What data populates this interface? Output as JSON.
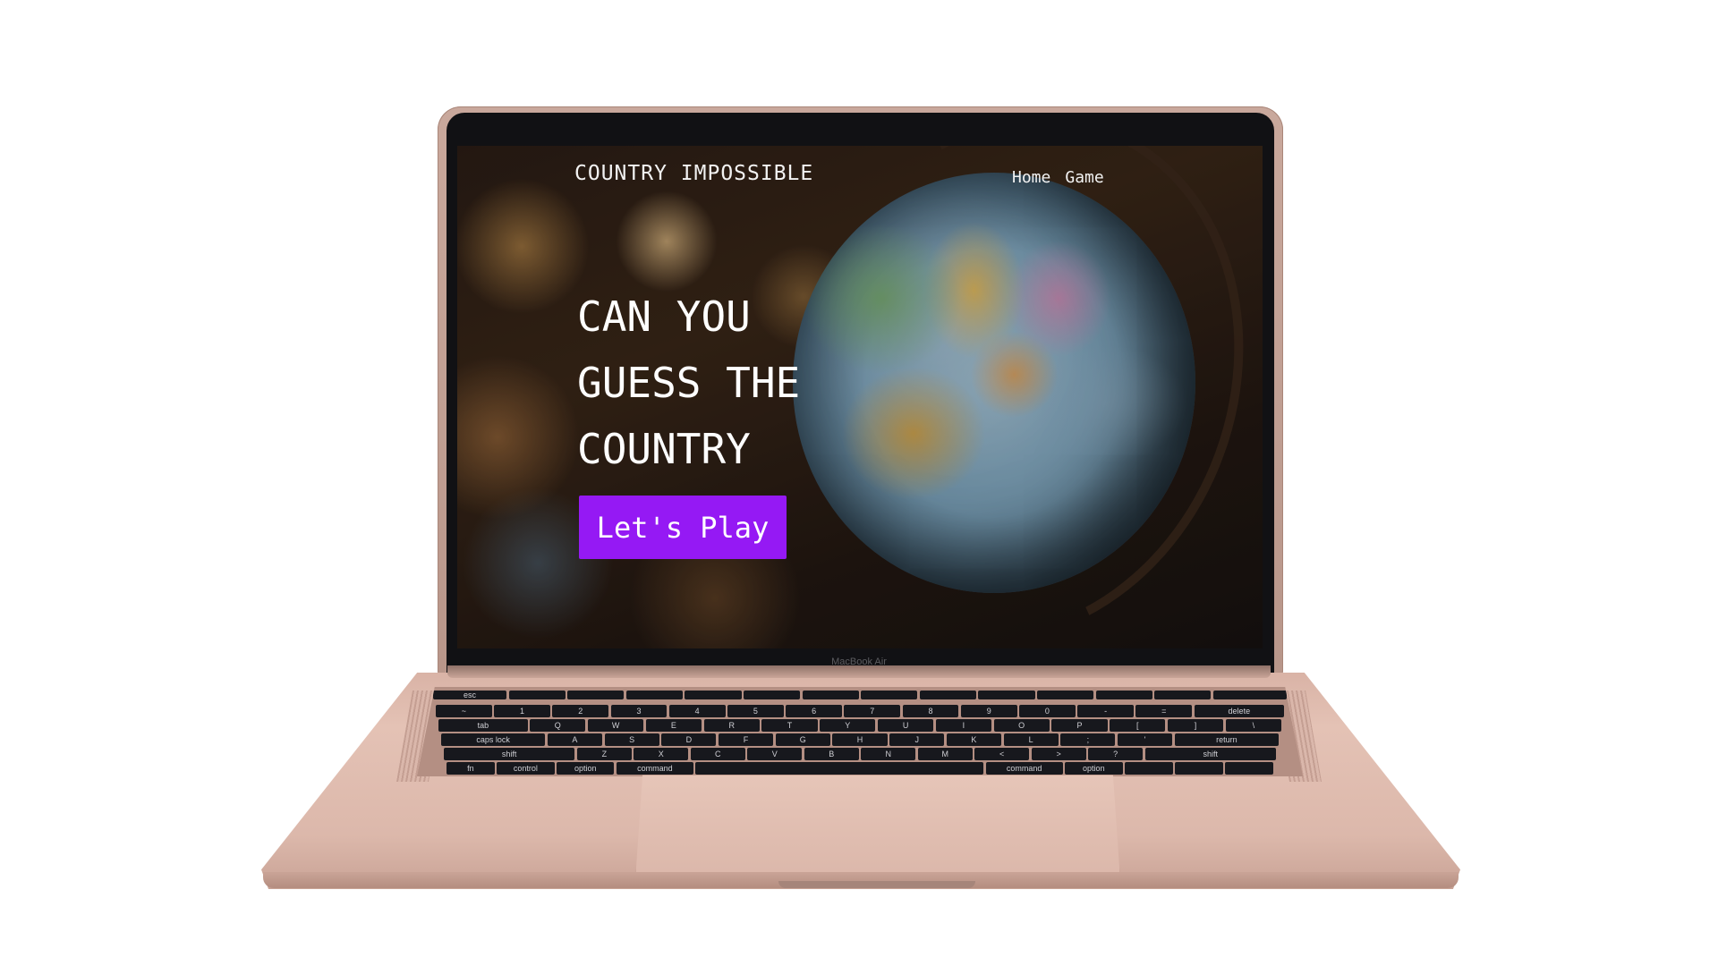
{
  "device": {
    "brand_label": "MacBook Air"
  },
  "site": {
    "logo": "COUNTRY IMPOSSIBLE",
    "nav": [
      {
        "label": "Home"
      },
      {
        "label": "Game"
      }
    ],
    "hero": {
      "lines": [
        "CAN YOU",
        "GUESS THE",
        "COUNTRY"
      ]
    },
    "cta": {
      "label": "Let's Play",
      "color": "#9519f4"
    }
  },
  "keyboard": {
    "rows": [
      [
        "esc",
        "",
        "",
        "",
        "",
        "",
        "",
        "",
        "",
        "",
        "",
        "",
        "",
        ""
      ],
      [
        "~",
        "1",
        "2",
        "3",
        "4",
        "5",
        "6",
        "7",
        "8",
        "9",
        "0",
        "-",
        "=",
        "delete"
      ],
      [
        "tab",
        "Q",
        "W",
        "E",
        "R",
        "T",
        "Y",
        "U",
        "I",
        "O",
        "P",
        "[",
        "]",
        "\\"
      ],
      [
        "caps lock",
        "A",
        "S",
        "D",
        "F",
        "G",
        "H",
        "J",
        "K",
        "L",
        ";",
        "'",
        "return"
      ],
      [
        "shift",
        "Z",
        "X",
        "C",
        "V",
        "B",
        "N",
        "M",
        "<",
        ">",
        "?",
        "shift"
      ],
      [
        "fn",
        "control",
        "option",
        "command",
        "",
        "command",
        "option",
        "",
        "",
        ""
      ]
    ]
  },
  "colors": {
    "body": "#dcb8ab",
    "bezel": "#111114",
    "key": "#17181d"
  }
}
